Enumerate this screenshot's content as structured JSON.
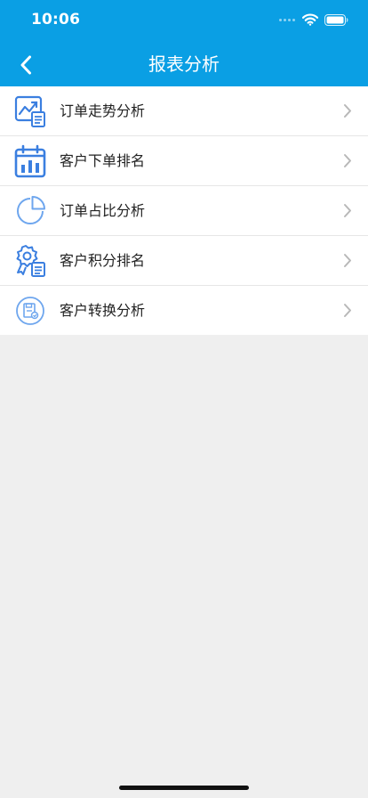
{
  "status_bar": {
    "time": "10:06",
    "icons": [
      "signal-icon",
      "wifi-icon",
      "battery-icon"
    ]
  },
  "nav": {
    "title": "报表分析",
    "back_icon": "chevron-left-icon"
  },
  "menu": [
    {
      "id": "order-trend",
      "label": "订单走势分析",
      "icon": "trend-chart-icon"
    },
    {
      "id": "customer-order-rank",
      "label": "客户下单排名",
      "icon": "bar-calendar-icon"
    },
    {
      "id": "order-ratio",
      "label": "订单占比分析",
      "icon": "pie-chart-icon"
    },
    {
      "id": "customer-points-rank",
      "label": "客户积分排名",
      "icon": "badge-document-icon"
    },
    {
      "id": "customer-conversion",
      "label": "客户转换分析",
      "icon": "conversion-icon"
    }
  ],
  "colors": {
    "header": "#0a9fe4",
    "icon_blue": "#3b7fe0",
    "icon_light_blue": "#6ea6ee",
    "background": "#efefef",
    "chevron": "#b8b8b8"
  }
}
